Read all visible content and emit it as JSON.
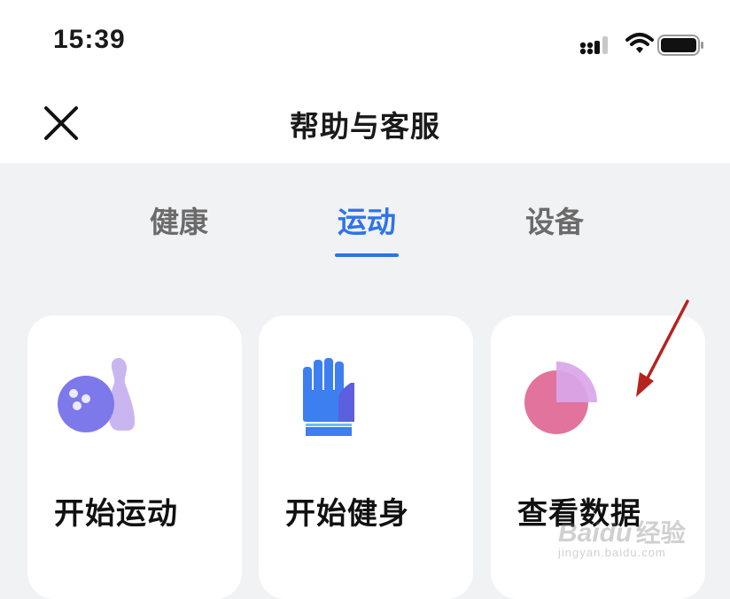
{
  "status_bar": {
    "time": "15:39"
  },
  "header": {
    "title": "帮助与客服"
  },
  "tabs": [
    {
      "label": "健康",
      "active": false
    },
    {
      "label": "运动",
      "active": true
    },
    {
      "label": "设备",
      "active": false
    }
  ],
  "cards": [
    {
      "label": "开始运动",
      "icon": "bowling-icon"
    },
    {
      "label": "开始健身",
      "icon": "glove-icon"
    },
    {
      "label": "查看数据",
      "icon": "pie-chart-icon"
    }
  ],
  "colors": {
    "accent": "#2f73e6",
    "background": "#f1f2f4",
    "annotation_arrow": "#b5231f"
  },
  "watermark": {
    "logo": "Baidu",
    "text": "经验",
    "url": "jingyan.baidu.com"
  }
}
